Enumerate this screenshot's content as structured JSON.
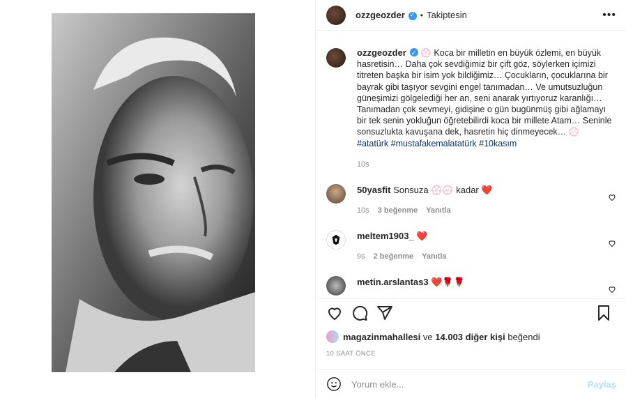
{
  "post": {
    "username": "ozzgeozder",
    "follow_status": "Takiptesin",
    "more_label": "•••"
  },
  "caption": {
    "username": "ozzgeozder",
    "text": "💮 Koca bir milletin en büyük özlemi, en büyük hasretisin… Daha çok sevdiğimiz bir çift göz, söylerken içimizi titreten başka bir isim yok bildiğimiz… Çocukların, çocuklarına bir bayrak gibi taşıyor sevgini engel tanımadan… Ve umutsuzluğun güneşimizi gölgelediği her an, seni anarak yırtıyoruz karanlığı… Tanımadan çok sevmeyi, gidişine o gün bugünmüş gibi ağlamayı bir tek senin yokluğun öğretebilirdi koca bir millete Atam… Seninle sonsuzlukta kavuşana dek, hasretin hiç dinmeyecek… 💮",
    "hashtags": [
      "#atatürk",
      "#mustafakemalatatürk",
      "#10kasım"
    ],
    "time": "10s"
  },
  "comments": [
    {
      "username": "50yasfit",
      "text": "Sonsuza 💮💮 kadar ❤️",
      "time": "10s",
      "likes": "3 beğenme",
      "reply": "Yanıtla"
    },
    {
      "username": "meltem1903_",
      "text": "❤️",
      "time": "9s",
      "likes": "2 beğenme",
      "reply": "Yanıtla"
    },
    {
      "username": "metin.arslantas3",
      "text": "❤️🌹🌹",
      "time": "",
      "likes": "",
      "reply": ""
    }
  ],
  "likes": {
    "user": "magazinmahallesi",
    "connector": "ve",
    "others": "14.003 diğer kişi",
    "suffix": "beğendi"
  },
  "posted_ago": "10 SAAT ÖNCE",
  "compose": {
    "placeholder": "Yorum ekle...",
    "share_label": "Paylaş"
  },
  "icons": {
    "like": "heart-icon",
    "comment": "comment-icon",
    "share": "paper-plane-icon",
    "save": "bookmark-icon",
    "emoji": "smiley-icon"
  },
  "colors": {
    "verified": "#3897f0",
    "hashtag": "#00376b",
    "muted": "#8e8e8e",
    "share_disabled": "#b2dffc",
    "heart": "#ed4956"
  }
}
